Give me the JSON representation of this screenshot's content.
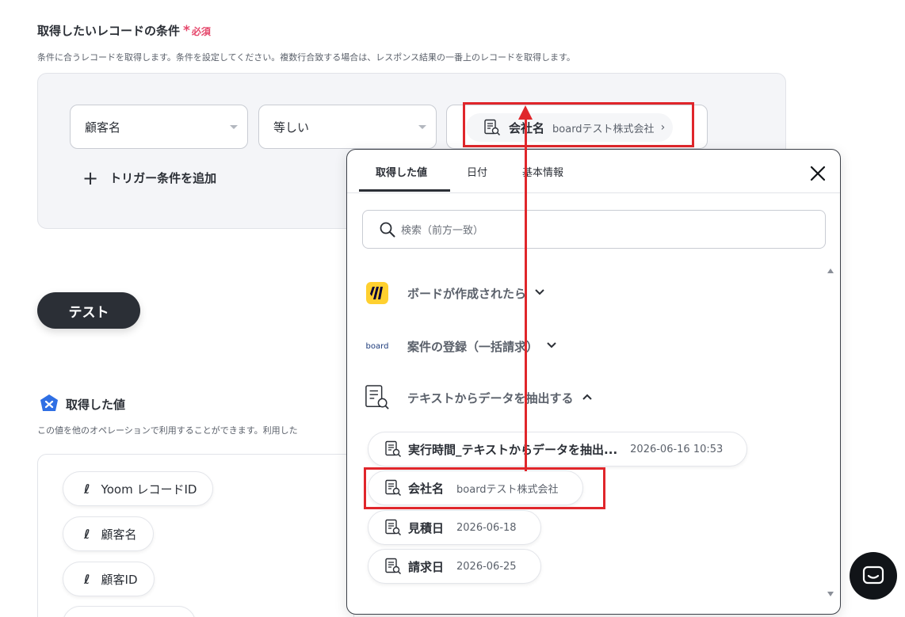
{
  "section": {
    "title": "取得したいレコードの条件",
    "required_star": "*",
    "required_label": "必須",
    "description": "条件に合うレコードを取得します。条件を設定してください。複数行合致する場合は、レスポンス結果の一番上のレコードを取得します。"
  },
  "condition": {
    "field_select": "顧客名",
    "operator_select": "等しい",
    "value_chip": {
      "label": "会社名",
      "value": "boardテスト株式会社",
      "icon": "document-search-icon"
    },
    "add_trigger_label": "トリガー条件を追加"
  },
  "test_button_label": "テスト",
  "acquired": {
    "title": "取得した値",
    "description": "この値を他のオペレーションで利用することができます。利用した",
    "items": [
      {
        "label": "Yoom レコードID"
      },
      {
        "label": "顧客名"
      },
      {
        "label": "顧客ID"
      }
    ]
  },
  "popup": {
    "tabs": [
      {
        "label": "取得した値",
        "active": true
      },
      {
        "label": "日付",
        "active": false
      },
      {
        "label": "基本情報",
        "active": false
      }
    ],
    "search_placeholder": "検索（前方一致）",
    "groups": [
      {
        "label": "ボードが作成されたら",
        "icon": "miro-logo",
        "expanded": false
      },
      {
        "label": "案件の登録（一括請求）",
        "icon": "board-logo",
        "icon_text": "board",
        "expanded": false
      },
      {
        "label": "テキストからデータを抽出する",
        "icon": "document-search-icon",
        "expanded": true
      }
    ],
    "items": [
      {
        "label": "実行時間_テキストからデータを抽出...",
        "value": "2026-06-16 10:53"
      },
      {
        "label": "会社名",
        "value": "boardテスト株式会社"
      },
      {
        "label": "見積日",
        "value": "2026-06-18"
      },
      {
        "label": "請求日",
        "value": "2026-06-25"
      }
    ]
  },
  "colors": {
    "accent_red": "#e0262b",
    "required_pink": "#e5476b",
    "dark": "#2b2f36",
    "miro_yellow": "#ffd02f",
    "yoom_blue": "#2f6fe4"
  }
}
